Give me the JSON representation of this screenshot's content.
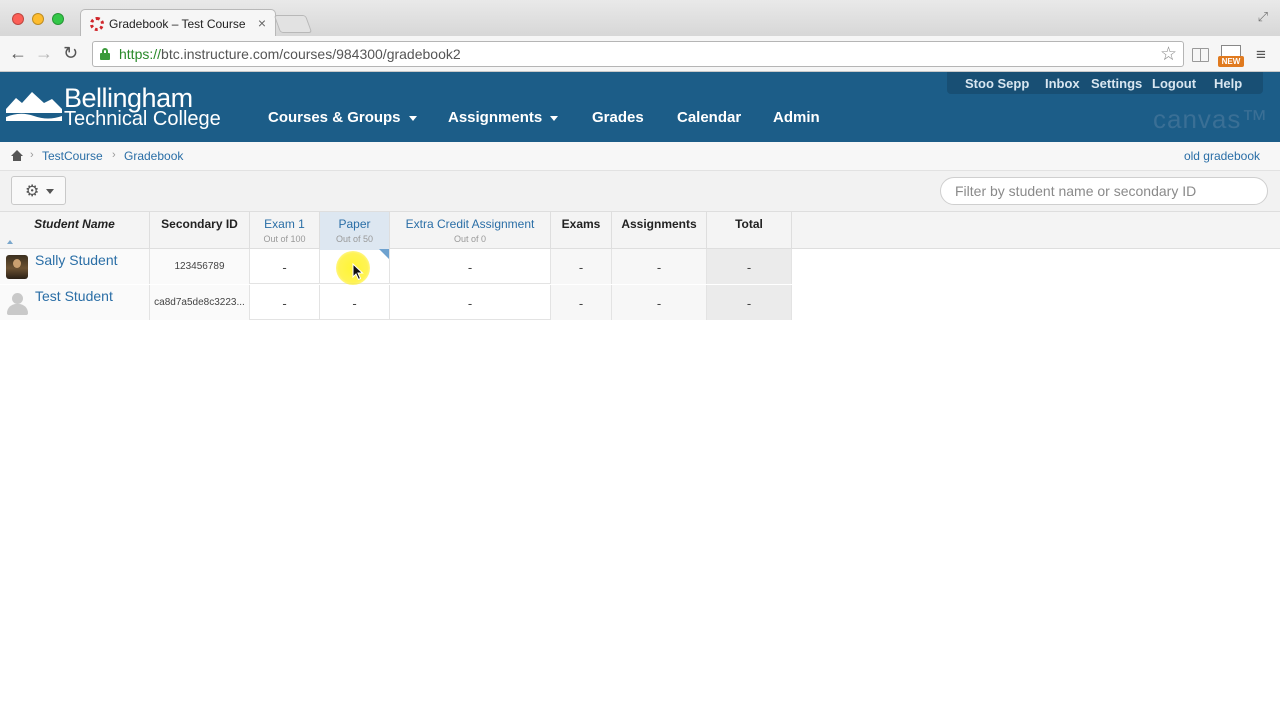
{
  "browser": {
    "tab_title": "Gradebook – Test Course",
    "tab_close": "×",
    "url_scheme": "https://",
    "url_rest": "btc.instructure.com/courses/984300/gradebook2",
    "ext_badge": "NEW"
  },
  "header": {
    "logo_line1": "Bellingham",
    "logo_line2": "Technical College",
    "util_links": [
      "Stoo Sepp",
      "Inbox",
      "Settings",
      "Logout",
      "Help"
    ],
    "nav": [
      "Courses & Groups",
      "Assignments",
      "Grades",
      "Calendar",
      "Admin"
    ],
    "brand": "canvas™"
  },
  "breadcrumb": {
    "items": [
      "TestCourse",
      "Gradebook"
    ],
    "right_link": "old gradebook"
  },
  "toolbar": {
    "filter_placeholder": "Filter by student name or secondary ID"
  },
  "grid": {
    "columns": [
      {
        "name": "Student Name",
        "sub": ""
      },
      {
        "name": "Secondary ID",
        "sub": ""
      },
      {
        "name": "Exam 1",
        "sub": "Out of 100"
      },
      {
        "name": "Paper",
        "sub": "Out of 50"
      },
      {
        "name": "Extra Credit Assignment",
        "sub": "Out of 0"
      },
      {
        "name": "Exams",
        "sub": ""
      },
      {
        "name": "Assignments",
        "sub": ""
      },
      {
        "name": "Total",
        "sub": ""
      }
    ],
    "rows": [
      {
        "student": "Sally Student",
        "secondary_id": "123456789",
        "scores": [
          "-",
          "-",
          "-",
          "-",
          "-",
          "-"
        ]
      },
      {
        "student": "Test Student",
        "secondary_id": "ca8d7a5de8c3223...",
        "scores": [
          "-",
          "-",
          "-",
          "-",
          "-",
          "-"
        ]
      }
    ]
  }
}
